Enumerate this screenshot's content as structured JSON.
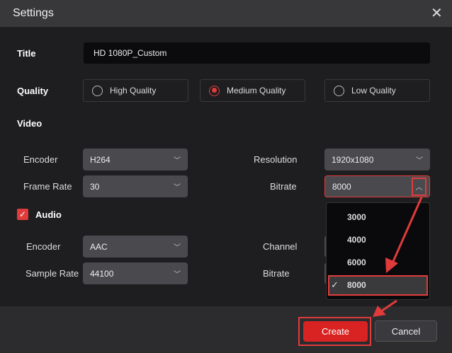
{
  "dialog": {
    "title": "Settings",
    "close_icon": "close-icon"
  },
  "title_field": {
    "label": "Title",
    "value": "HD 1080P_Custom"
  },
  "quality": {
    "label": "Quality",
    "options": [
      "High Quality",
      "Medium Quality",
      "Low Quality"
    ],
    "selected": "Medium Quality"
  },
  "video": {
    "label": "Video",
    "encoder_label": "Encoder",
    "encoder": "H264",
    "resolution_label": "Resolution",
    "resolution": "1920x1080",
    "framerate_label": "Frame Rate",
    "framerate": "30",
    "bitrate_label": "Bitrate",
    "bitrate": "8000"
  },
  "bitrate_dropdown": {
    "options": [
      "3000",
      "4000",
      "6000",
      "8000"
    ],
    "selected": "8000"
  },
  "audio": {
    "label": "Audio",
    "checked": true,
    "encoder_label": "Encoder",
    "encoder": "AAC",
    "samplerate_label": "Sample Rate",
    "samplerate": "44100",
    "channel_label": "Channel",
    "bitrate_label": "Bitrate"
  },
  "footer": {
    "create": "Create",
    "cancel": "Cancel"
  },
  "colors": {
    "accent": "#e03b3b",
    "button": "#d92323"
  }
}
